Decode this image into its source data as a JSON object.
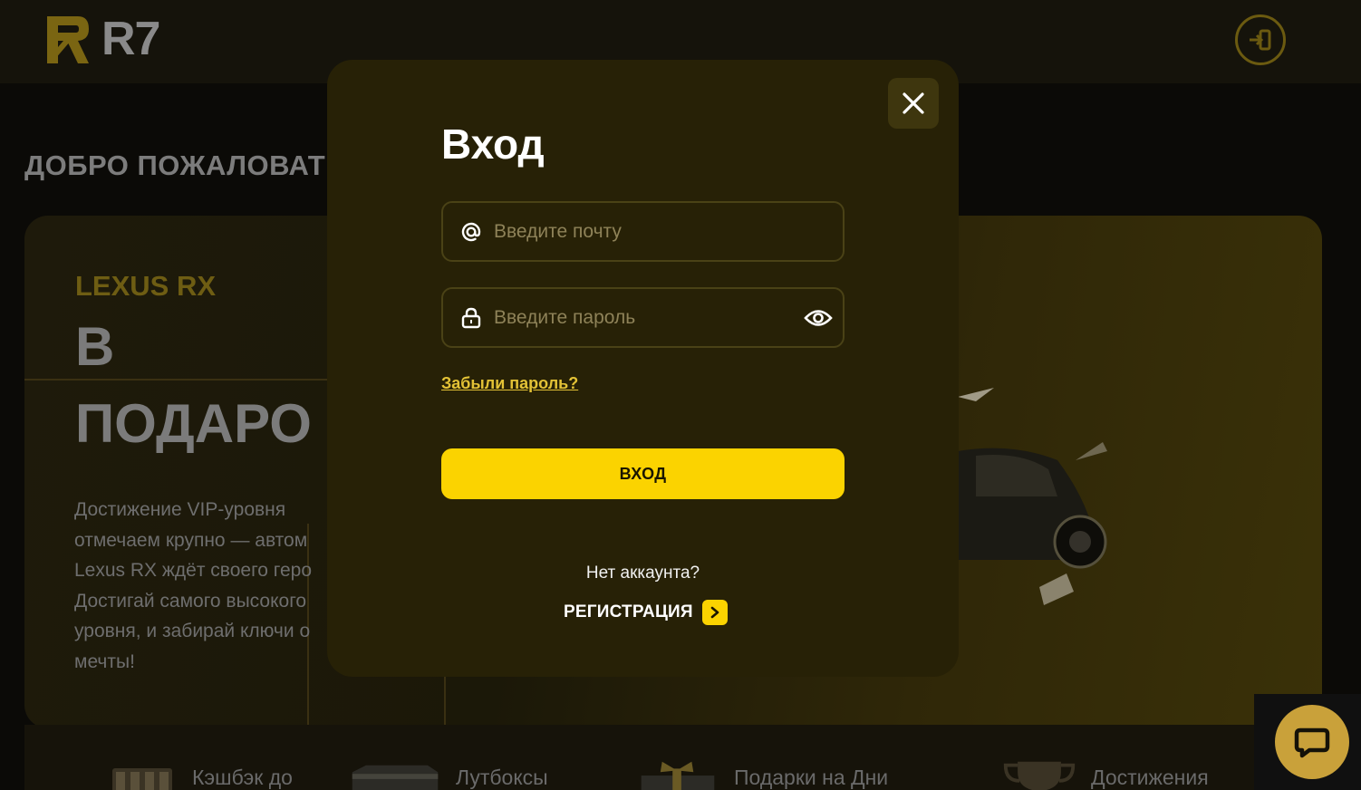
{
  "header": {
    "logo_text": "R7",
    "login_icon": "login-icon"
  },
  "background": {
    "welcome": "ДОБРО ПОЖАЛОВАТ",
    "hero": {
      "tag": "LEXUS RX",
      "title_line1": "В",
      "title_line2": "ПОДАРО",
      "description_lines": [
        "Достижение VIP-уровня",
        "отмечаем крупно — автом",
        "Lexus RX ждёт своего геро",
        "Достигай самого высокого",
        "уровня, и забирай ключи о",
        "мечты!"
      ]
    },
    "features": [
      {
        "label": "Кэшбэк до",
        "icon": "cashback-icon"
      },
      {
        "label": "Лутбоксы",
        "icon": "lootbox-icon"
      },
      {
        "label": "Подарки на Дни",
        "icon": "gift-icon"
      },
      {
        "label": "Достижения",
        "icon": "trophy-icon"
      }
    ],
    "chat_icon": "chat-icon"
  },
  "modal": {
    "title": "Вход",
    "email": {
      "placeholder": "Введите почту",
      "value": "",
      "icon": "at-icon"
    },
    "password": {
      "placeholder": "Введите пароль",
      "value": "",
      "icon": "lock-icon",
      "toggle_icon": "eye-icon"
    },
    "forgot_label": "Забыли пароль?",
    "submit_label": "ВХОД",
    "no_account": "Нет аккаунта?",
    "register_label": "РЕГИСТРАЦИЯ",
    "close_icon": "close-icon"
  },
  "colors": {
    "accent": "#fbd300",
    "modal_bg": "#272106",
    "link": "#e3c236"
  }
}
